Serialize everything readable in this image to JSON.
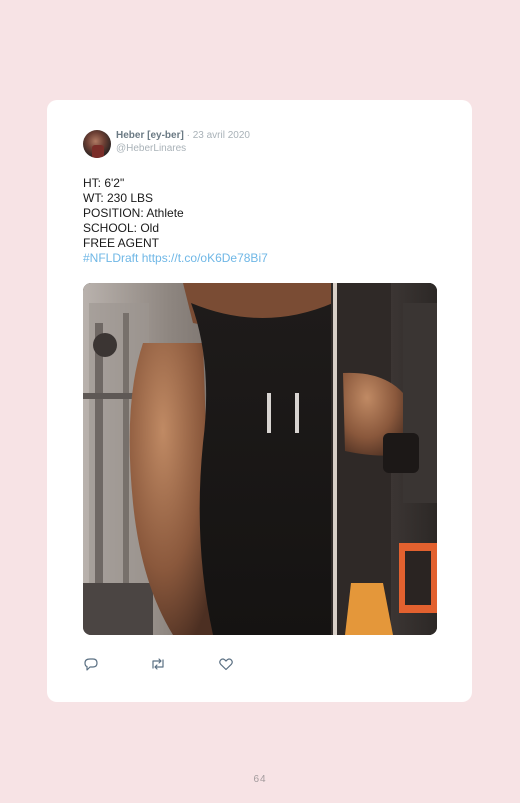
{
  "tweet": {
    "author_name": "Heber [ey-ber]",
    "separator": " · ",
    "date": "23 avril 2020",
    "handle": "@HeberLinares",
    "lines": [
      "HT: 6'2\"",
      "WT: 230 LBS",
      "POSITION: Athlete",
      "SCHOOL: Old",
      "FREE AGENT"
    ],
    "hashtag": "#NFLDraft",
    "link": "https://t.co/oK6De78Bi7",
    "image_icon": "photo-gym-selfie"
  },
  "actions": [
    {
      "icon": "reply-icon"
    },
    {
      "icon": "retweet-icon"
    },
    {
      "icon": "like-icon"
    }
  ],
  "colors": {
    "page_background": "#f7e3e5",
    "card_background": "#ffffff",
    "link": "#6fb7e6",
    "muted": "#a9b2b8",
    "action_icon": "#5b7083"
  },
  "page_number": "64"
}
